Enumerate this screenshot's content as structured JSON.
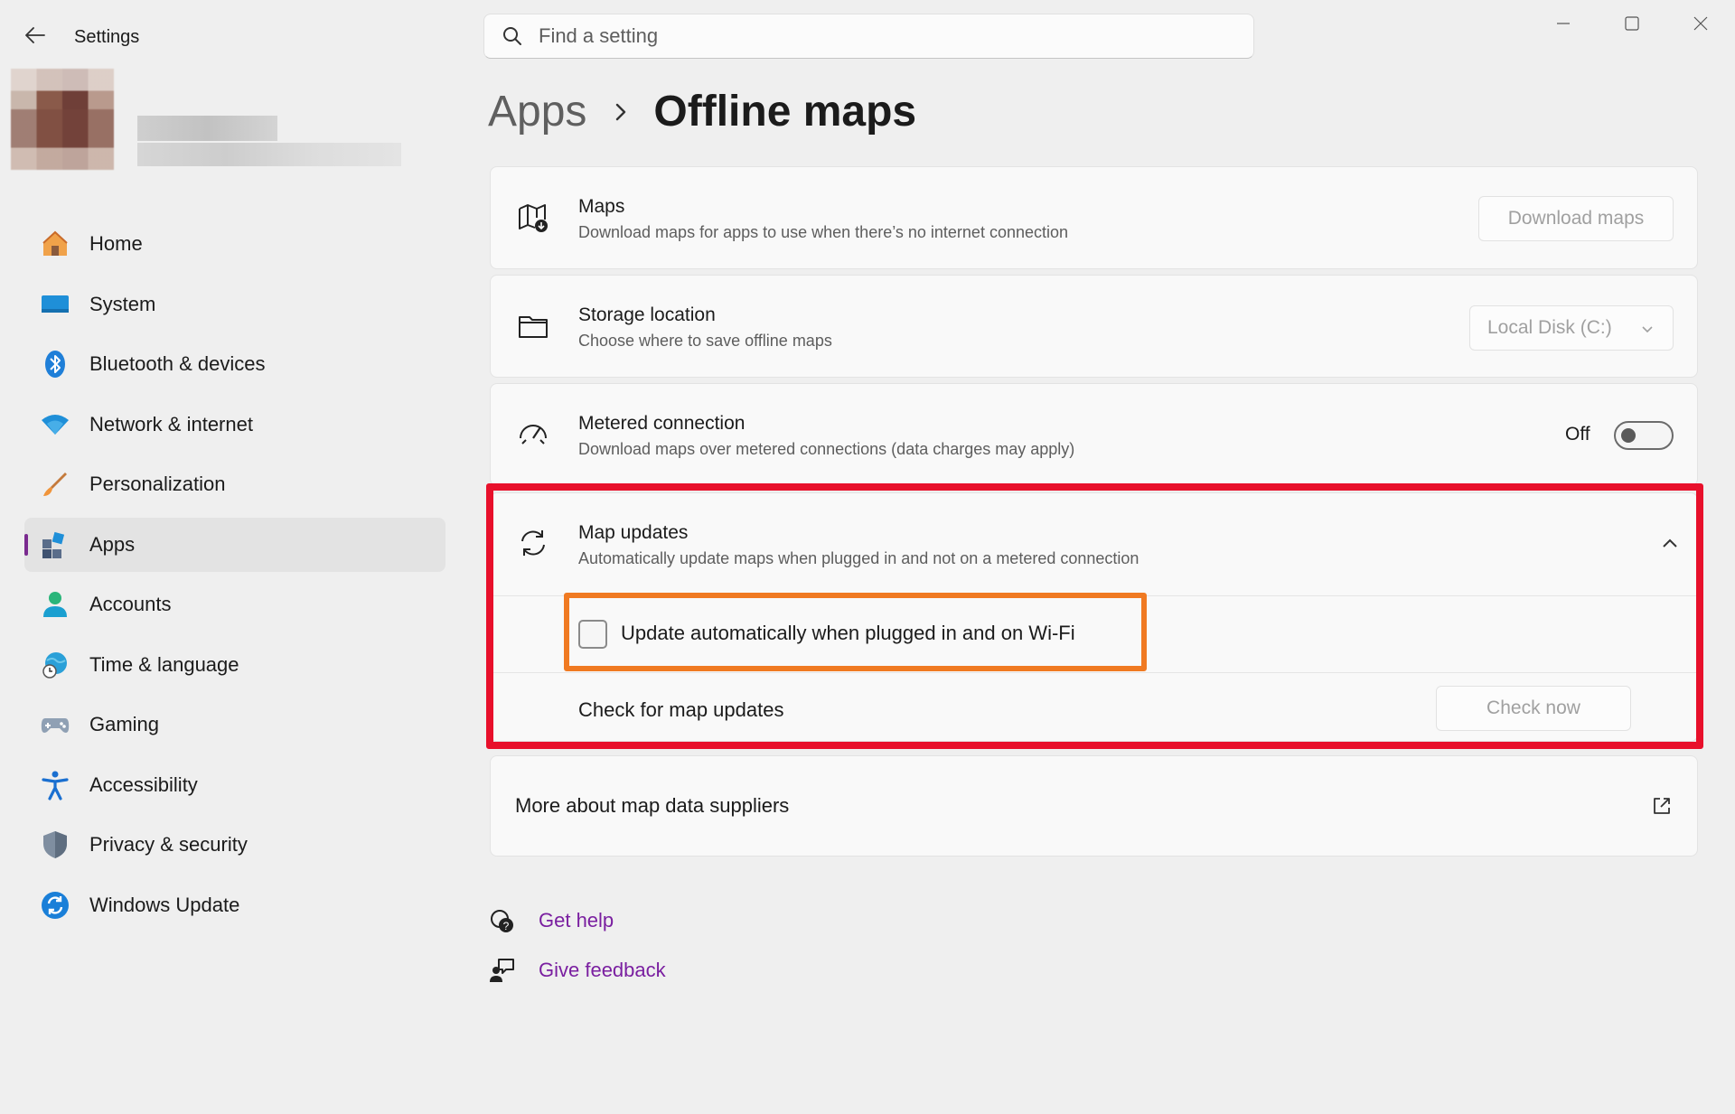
{
  "window": {
    "title": "Settings"
  },
  "search": {
    "placeholder": "Find a setting"
  },
  "sidebar": {
    "items": [
      {
        "label": "Home",
        "icon": "home-icon"
      },
      {
        "label": "System",
        "icon": "system-icon"
      },
      {
        "label": "Bluetooth & devices",
        "icon": "bluetooth-icon"
      },
      {
        "label": "Network & internet",
        "icon": "wifi-icon"
      },
      {
        "label": "Personalization",
        "icon": "brush-icon"
      },
      {
        "label": "Apps",
        "icon": "apps-icon",
        "active": true
      },
      {
        "label": "Accounts",
        "icon": "account-icon"
      },
      {
        "label": "Time & language",
        "icon": "globe-clock-icon"
      },
      {
        "label": "Gaming",
        "icon": "gamepad-icon"
      },
      {
        "label": "Accessibility",
        "icon": "accessibility-icon"
      },
      {
        "label": "Privacy & security",
        "icon": "shield-icon"
      },
      {
        "label": "Windows Update",
        "icon": "update-icon"
      }
    ]
  },
  "breadcrumb": {
    "parent": "Apps",
    "current": "Offline maps"
  },
  "settings": {
    "maps": {
      "title": "Maps",
      "subtitle": "Download maps for apps to use when there’s no internet connection",
      "button": "Download maps"
    },
    "storage": {
      "title": "Storage location",
      "subtitle": "Choose where to save offline maps",
      "selected": "Local Disk (C:)"
    },
    "metered": {
      "title": "Metered connection",
      "subtitle": "Download maps over metered connections (data charges may apply)",
      "state": "Off"
    },
    "updates": {
      "title": "Map updates",
      "subtitle": "Automatically update maps when plugged in and not on a metered connection",
      "checkbox_label": "Update automatically when plugged in and on Wi-Fi",
      "check_label": "Check for map updates",
      "check_button": "Check now"
    },
    "suppliers": {
      "title": "More about map data suppliers"
    }
  },
  "links": {
    "help": "Get help",
    "feedback": "Give feedback"
  },
  "colors": {
    "accent": "#7a2a8f",
    "highlight_red": "#e8102b",
    "highlight_orange": "#f07a22"
  }
}
